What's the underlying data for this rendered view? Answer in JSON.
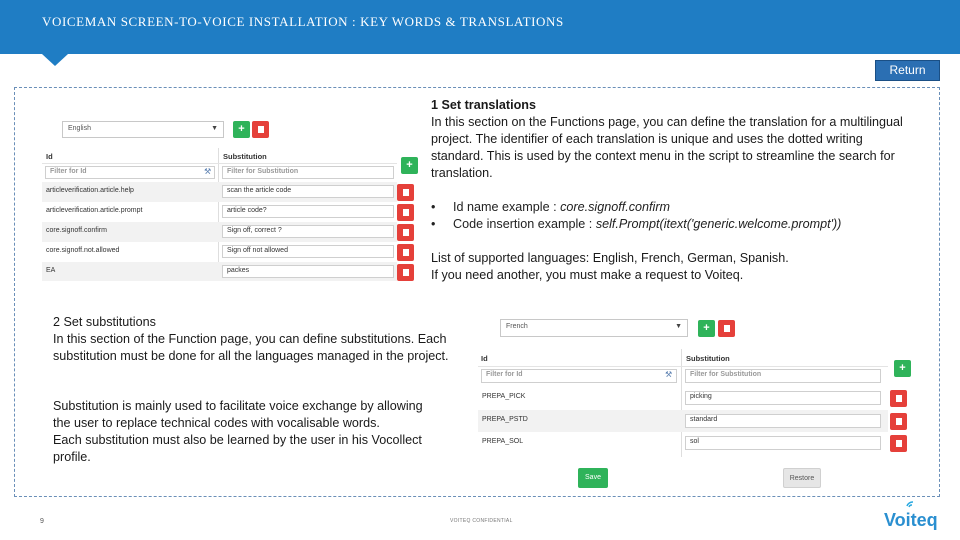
{
  "header": {
    "title": "VOICEMAN SCREEN-TO-VOICE INSTALLATION : KEY WORDS &  TRANSLATIONS",
    "accent_color": "#1f7dc4"
  },
  "return_button": {
    "label": "Return"
  },
  "section1": {
    "heading": "1 Set translations",
    "paragraph": "In this section on the Functions page, you can define the translation for a multilingual project. The identifier of each translation is unique and uses the dotted writing standard. This is used by the context menu in the script to streamline the search for translation.",
    "bullets": [
      {
        "label": "Id name example : ",
        "example": "core.signoff.confirm"
      },
      {
        "label": "Code insertion example : ",
        "example": "self.Prompt(itext('generic.welcome.prompt'))"
      }
    ],
    "languages_line1": "List of supported languages: English, French, German, Spanish.",
    "languages_line2": "If you need another, you must make a request to Voiteq."
  },
  "section2": {
    "heading": "2 Set substitutions",
    "paragraph": "In this section of the Function page, you can define substitutions. Each substitution must be done for all the languages managed in the project.",
    "paragraph2": "Substitution is mainly used to facilitate voice exchange by allowing the user to replace technical codes with vocalisable words.",
    "paragraph3": "Each substitution must also be learned by the user in his Vocollect profile."
  },
  "translations_panel": {
    "language": "English",
    "col_id": "Id",
    "col_sub": "Substitution",
    "filter_id_placeholder": "Filter for Id",
    "filter_sub_placeholder": "Filter for Substitution",
    "rows": [
      {
        "id": "articleverification.article.help",
        "value": "scan the article code"
      },
      {
        "id": "articleverification.article.prompt",
        "value": "article code?"
      },
      {
        "id": "core.signoff.confirm",
        "value": "Sign off, correct ?"
      },
      {
        "id": "core.signoff.not.allowed",
        "value": "Sign off not allowed"
      },
      {
        "id": "EA",
        "value": "packes"
      }
    ]
  },
  "substitutions_panel": {
    "language": "French",
    "col_id": "Id",
    "col_sub": "Substitution",
    "filter_id_placeholder": "Filter for Id",
    "filter_sub_placeholder": "Filter for Substitution",
    "rows": [
      {
        "id": "PREPA_PICK",
        "value": "picking"
      },
      {
        "id": "PREPA_PSTD",
        "value": "standard"
      },
      {
        "id": "PREPA_SOL",
        "value": "sol"
      }
    ],
    "save_label": "Save",
    "restore_label": "Restore"
  },
  "footer": {
    "page_number": "9",
    "confidential": "VOITEQ CONFIDENTIAL",
    "logo_text": "Voiteq"
  }
}
